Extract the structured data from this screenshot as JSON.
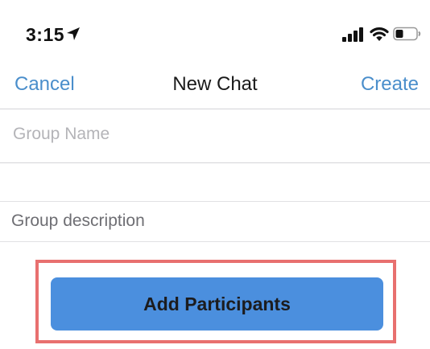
{
  "status_bar": {
    "time": "3:15",
    "icons": [
      "location-arrow-icon",
      "cellular-signal-icon",
      "wifi-icon",
      "battery-icon"
    ]
  },
  "nav": {
    "cancel_label": "Cancel",
    "title": "New Chat",
    "create_label": "Create",
    "accent_color": "#4a8ecb"
  },
  "form": {
    "group_name": {
      "value": "",
      "placeholder": "Group Name"
    },
    "group_description": {
      "value": "",
      "placeholder": "Group description"
    }
  },
  "actions": {
    "add_participants_label": "Add Participants",
    "button_color": "#4b8fde",
    "highlight_color": "#e8706f"
  }
}
